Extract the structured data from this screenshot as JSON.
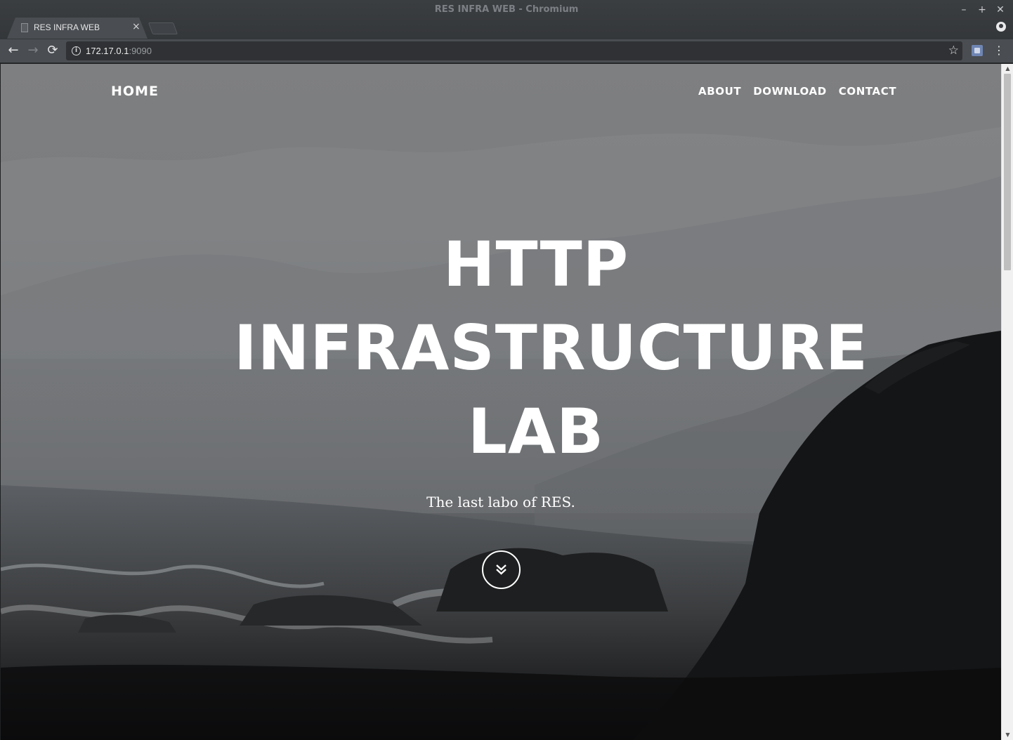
{
  "window": {
    "title": "RES INFRA WEB - Chromium",
    "controls": [
      "–",
      "+",
      "✕"
    ]
  },
  "tab": {
    "label": "RES INFRA WEB",
    "close": "×"
  },
  "toolbar": {
    "back": "←",
    "forward": "→",
    "reload": "⟳",
    "url_host": "172.17.0.1",
    "url_port": ":9090",
    "bookmark": "☆",
    "menu": "⋮"
  },
  "site": {
    "brand": "HOME",
    "nav": [
      "ABOUT",
      "DOWNLOAD",
      "CONTACT"
    ],
    "hero_title_lines": [
      "HTTP",
      "INFRASTRUCTURE",
      "LAB"
    ],
    "hero_subtitle": "The last labo of RES."
  },
  "icons": {
    "info": "i",
    "scroll_up": "▲",
    "scroll_down": "▼"
  }
}
